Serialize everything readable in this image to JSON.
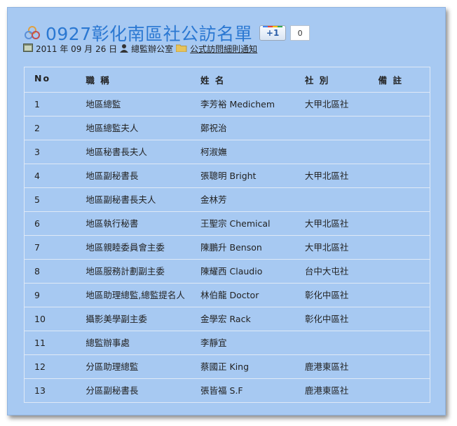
{
  "header": {
    "title": "0927彰化南區社公訪名單",
    "gplus_label": "+1",
    "gplus_count": "0"
  },
  "meta": {
    "date": "2011 年 09 月 26 日",
    "author": "總監辦公室",
    "category": "公式訪問細則通知"
  },
  "table": {
    "headers": [
      "No",
      "職 稱",
      "姓 名",
      "社 別",
      "備 註"
    ],
    "rows": [
      [
        "1",
        "地區總監",
        "李芳裕 Medichem",
        "大甲北區社",
        ""
      ],
      [
        "2",
        "地區總監夫人",
        "鄭祝治",
        "",
        ""
      ],
      [
        "3",
        "地區秘書長夫人",
        "柯淑嫵",
        "",
        ""
      ],
      [
        "4",
        "地區副秘書長",
        "張聰明 Bright",
        "大甲北區社",
        ""
      ],
      [
        "5",
        "地區副秘書長夫人",
        "金林芳",
        "",
        ""
      ],
      [
        "6",
        "地區執行秘書",
        "王聖宗 Chemical",
        "大甲北區社",
        ""
      ],
      [
        "7",
        "地區親睦委員會主委",
        "陳鵬升 Benson",
        "大甲北區社",
        ""
      ],
      [
        "8",
        "地區服務計劃副主委",
        "陳耀西 Claudio",
        "台中大屯社",
        ""
      ],
      [
        "9",
        "地區助理總監,總監提名人",
        "林伯龍 Doctor",
        "彰化中區社",
        ""
      ],
      [
        "10",
        "攝影美學副主委",
        "金學宏 Rack",
        "彰化中區社",
        ""
      ],
      [
        "11",
        "總監辦事處",
        "李靜宜",
        "",
        ""
      ],
      [
        "12",
        "分區助理總監",
        "蔡國正 King",
        "鹿港東區社",
        ""
      ],
      [
        "13",
        "分區副秘書長",
        "張皆福 S.F",
        "鹿港東區社",
        ""
      ]
    ]
  },
  "colors": {
    "panel_bg": "#a7c9f2",
    "title": "#2b78d2",
    "grid_line": "#dfe9f6"
  }
}
